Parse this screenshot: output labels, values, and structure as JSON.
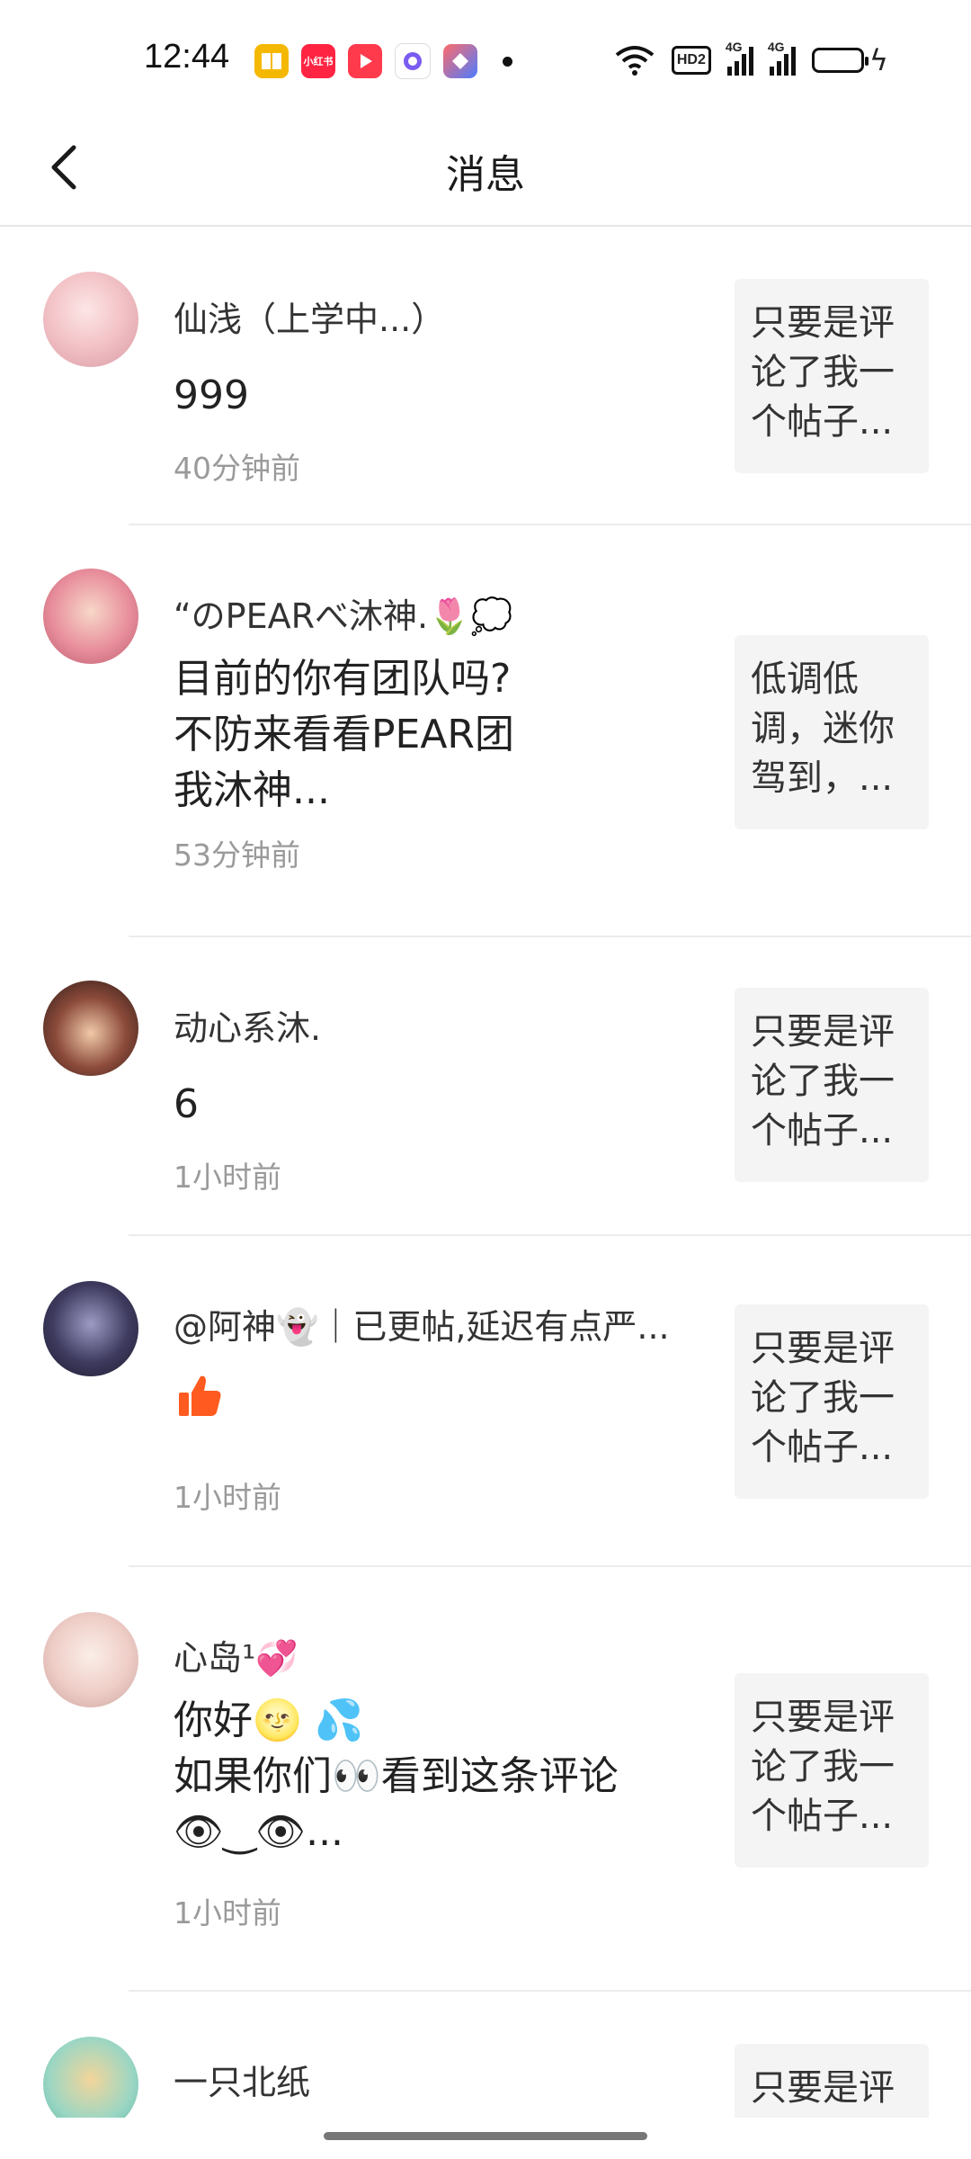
{
  "status_bar": {
    "time": "12:44",
    "app_icon_xhs": "小红书",
    "network_badge": "HD2",
    "signal_1": "4G",
    "signal_2": "4G"
  },
  "header": {
    "title": "消息"
  },
  "messages": [
    {
      "name": "仙浅（上学中...）",
      "content": "999",
      "time": "40分钟前",
      "preview": "只要是评论了我一个帖子..."
    },
    {
      "name": "“のPEARべ沐神.🌷💭",
      "content": "目前的你有团队吗?\n不防来看看PEAR团\n我沐神...",
      "time": "53分钟前",
      "preview": "低调低调，迷你驾到，..."
    },
    {
      "name": "动心系沐.",
      "content": "6",
      "time": "1小时前",
      "preview": "只要是评论了我一个帖子..."
    },
    {
      "name": "@阿神👻｜已更帖,延迟有点严...",
      "content": "👍",
      "time": "1小时前",
      "preview": "只要是评论了我一个帖子..."
    },
    {
      "name": "心岛¹💞",
      "content": "你好🌝 💦\n如果你们👀看到这条评论\n👁‿👁...",
      "time": "1小时前",
      "preview": "只要是评论了我一个帖子..."
    },
    {
      "name": "一只北纸",
      "content": "",
      "time": "",
      "preview": "只要是评"
    }
  ],
  "colors": {
    "accent_like": "#ff5a1f",
    "divider": "#ececec",
    "thumb_bg": "#f4f4f4"
  },
  "icons": [
    "back-arrow-icon",
    "wifi-icon",
    "signal-icon",
    "battery-icon",
    "charging-bolt-icon",
    "thumbs-up-icon"
  ]
}
